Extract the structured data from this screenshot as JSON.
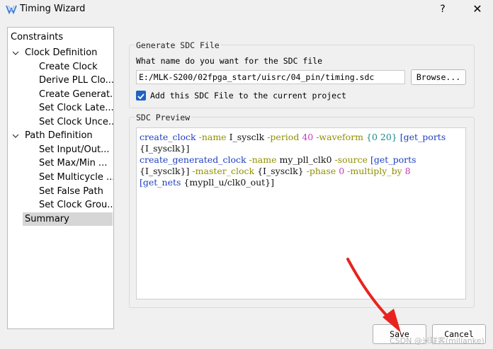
{
  "window": {
    "title": "Timing Wizard",
    "help_label": "?",
    "close_label": "✕"
  },
  "nav": {
    "items": [
      {
        "label": "Constraints",
        "level": 0
      },
      {
        "label": "Clock Definition",
        "level": 1
      },
      {
        "label": "Create Clock",
        "level": 2
      },
      {
        "label": "Derive PLL Clo...",
        "level": 2
      },
      {
        "label": "Create Generat...",
        "level": 2
      },
      {
        "label": "Set Clock Late...",
        "level": 2
      },
      {
        "label": "Set Clock Unce...",
        "level": 2
      },
      {
        "label": "Path Definition",
        "level": 1
      },
      {
        "label": "Set Input/Out...",
        "level": 2
      },
      {
        "label": "Set Max/Min ...",
        "level": 2
      },
      {
        "label": "Set Multicycle ...",
        "level": 2
      },
      {
        "label": "Set False Path",
        "level": 2
      },
      {
        "label": "Set Clock Grou...",
        "level": 2
      },
      {
        "label": "Summary",
        "level": 1,
        "selected": true
      }
    ]
  },
  "generate": {
    "group_title": "Generate SDC File",
    "question": "What name do you want for the SDC file",
    "file_path": "E:/MLK-S200/02fpga_start/uisrc/04_pin/timing.sdc",
    "browse_label": "Browse...",
    "checkbox_label": "Add this SDC File to the current project",
    "checkbox_checked": true
  },
  "preview": {
    "group_title": "SDC Preview",
    "line1": {
      "cmd": "create_clock",
      "opt1": "-name",
      "v1": "I_sysclk",
      "opt2": "-period",
      "n1": "40",
      "opt3": "-waveform",
      "b1": "{0 20}",
      "b2": "[get_ports"
    },
    "line2": {
      "b3": "{I_sysclk}]"
    },
    "line3": {
      "cmd": "create_generated_clock",
      "opt1": "-name",
      "v1": "my_pll_clk0",
      "opt2": "-source",
      "b1": "[get_ports"
    },
    "line4": {
      "b2": "{I_sysclk}]",
      "opt1": "-master_clock",
      "v1": "{I_sysclk}",
      "opt2": "-phase",
      "n1": "0",
      "opt3": "-multiply_by",
      "n2": "8"
    },
    "line5": {
      "b1": "[get_nets",
      "v1": "{mypll_u/clk0_out}]"
    }
  },
  "footer": {
    "save_label": "Save",
    "cancel_label": "Cancel"
  },
  "watermark": "CSDN @米联客(milianke)",
  "colors": {
    "keyword": "#1e3fbf",
    "option": "#8f8f00",
    "number": "#c23bbd",
    "annotation_arrow": "#e8231f",
    "checkbox": "#1e63c4"
  }
}
